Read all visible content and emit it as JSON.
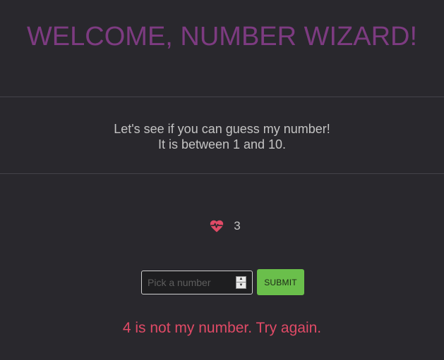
{
  "header": {
    "title": "WELCOME, NUMBER WIZARD!"
  },
  "intro": {
    "line1": "Let's see if you can guess my number!",
    "line2": "It is between 1 and 10."
  },
  "lives": {
    "icon": "heartbeat-icon",
    "count": "3"
  },
  "guess_form": {
    "input_value": "",
    "input_placeholder": "Pick a number",
    "submit_label": "SUBMIT"
  },
  "feedback": {
    "message": "4 is not my number. Try again."
  },
  "colors": {
    "background": "#29282d",
    "title": "#7d3b81",
    "heart": "#e04a66",
    "submit": "#6abf4b",
    "message": "#e04a66"
  }
}
